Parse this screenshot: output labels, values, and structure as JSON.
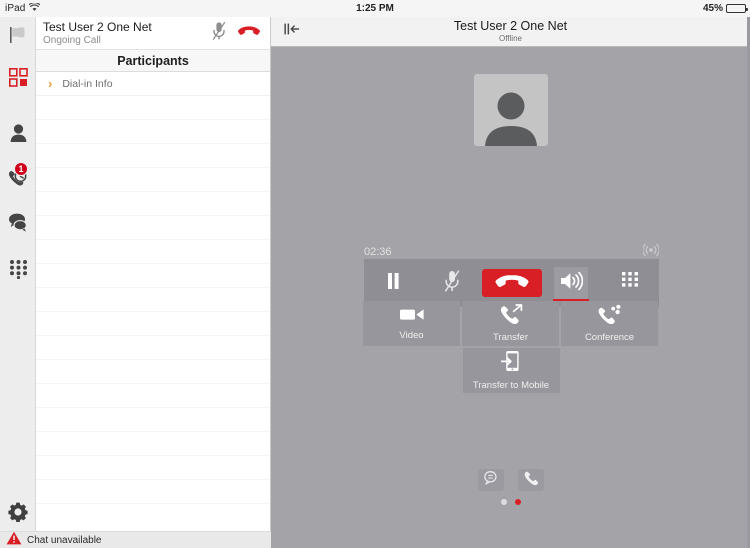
{
  "statusbar": {
    "device": "iPad",
    "wifi_icon": "wifi-icon",
    "time": "1:25 PM",
    "battery_percent": "45%",
    "battery_level": 45
  },
  "rail": {
    "items": [
      {
        "name": "flag-icon",
        "label": "Flag",
        "badge": null
      },
      {
        "name": "grid-icon",
        "label": "Dashboard",
        "badge": null
      },
      {
        "name": "contacts-icon",
        "label": "Contacts",
        "badge": null
      },
      {
        "name": "call-history-icon",
        "label": "History",
        "badge": "1"
      },
      {
        "name": "chat-icon",
        "label": "Chat",
        "badge": null
      },
      {
        "name": "dialpad-icon",
        "label": "Dialpad",
        "badge": null
      }
    ],
    "settings": {
      "name": "gear-icon",
      "label": "Settings"
    }
  },
  "panel": {
    "header": {
      "title": "Test User 2 One Net",
      "subtitle": "Ongoing Call",
      "mute_icon": "microphone-muted-icon",
      "hangup_icon": "hangup-icon"
    },
    "section_title": "Participants",
    "rows": [
      {
        "label": "Dial-in Info",
        "chevron": "›"
      }
    ]
  },
  "chatbar": {
    "warning_icon": "warning-triangle-icon",
    "text": "Chat unavailable"
  },
  "stage": {
    "nav": {
      "collapse_icon": "collapse-panel-icon",
      "title": "Test User 2 One Net",
      "subtitle": "Offline"
    },
    "avatar": {
      "name": "avatar-placeholder"
    },
    "call": {
      "timer": "02:36",
      "broadcast_icon": "wireless-broadcast-icon"
    },
    "controls": [
      {
        "name": "hold-button",
        "icon": "pause-icon",
        "state": "normal"
      },
      {
        "name": "mute-button",
        "icon": "microphone-muted-icon",
        "state": "muted"
      },
      {
        "name": "hangup-button",
        "icon": "hangup-icon",
        "state": "danger"
      },
      {
        "name": "speaker-button",
        "icon": "speaker-icon",
        "state": "active"
      },
      {
        "name": "dialpad-button",
        "icon": "dialpad-icon",
        "state": "normal"
      }
    ],
    "actions": [
      {
        "name": "video-button",
        "icon": "video-camera-icon",
        "label": "Video"
      },
      {
        "name": "transfer-button",
        "icon": "call-transfer-icon",
        "label": "Transfer"
      },
      {
        "name": "conference-button",
        "icon": "conference-call-icon",
        "label": "Conference"
      },
      {
        "name": "transfer-to-mobile-button",
        "icon": "mobile-transfer-icon",
        "label": "Transfer to Mobile"
      }
    ],
    "dock": [
      {
        "name": "chat-tab-button",
        "icon": "chat-bubble-icon"
      },
      {
        "name": "call-tab-button",
        "icon": "phone-handset-icon"
      }
    ],
    "page_dots": [
      {
        "active": false
      },
      {
        "active": true
      }
    ]
  },
  "colors": {
    "brand_red": "#d81f26",
    "accent_orange": "#e8a33d",
    "stage_bg": "#a3a3a8",
    "control_bar": "#8e8e94",
    "rail_bg": "#ededed"
  }
}
